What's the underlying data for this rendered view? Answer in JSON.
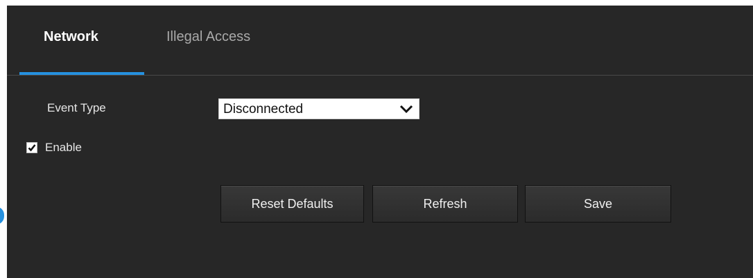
{
  "tabs": [
    {
      "label": "Network",
      "active": true
    },
    {
      "label": "Illegal Access",
      "active": false
    }
  ],
  "form": {
    "event_type_label": "Event Type",
    "event_type_value": "Disconnected",
    "enable_label": "Enable",
    "enable_checked": true
  },
  "buttons": {
    "reset_defaults": "Reset Defaults",
    "refresh": "Refresh",
    "save": "Save"
  },
  "icons": {
    "dropdown": "chevron-down-icon",
    "checkbox_mark": "checkmark-icon",
    "side_handle": "side-panel-handle"
  },
  "colors": {
    "panel_background": "#272727",
    "accent": "#2591e0",
    "active_tab_text": "#ffffff",
    "inactive_tab_text": "#a9a9a9"
  }
}
